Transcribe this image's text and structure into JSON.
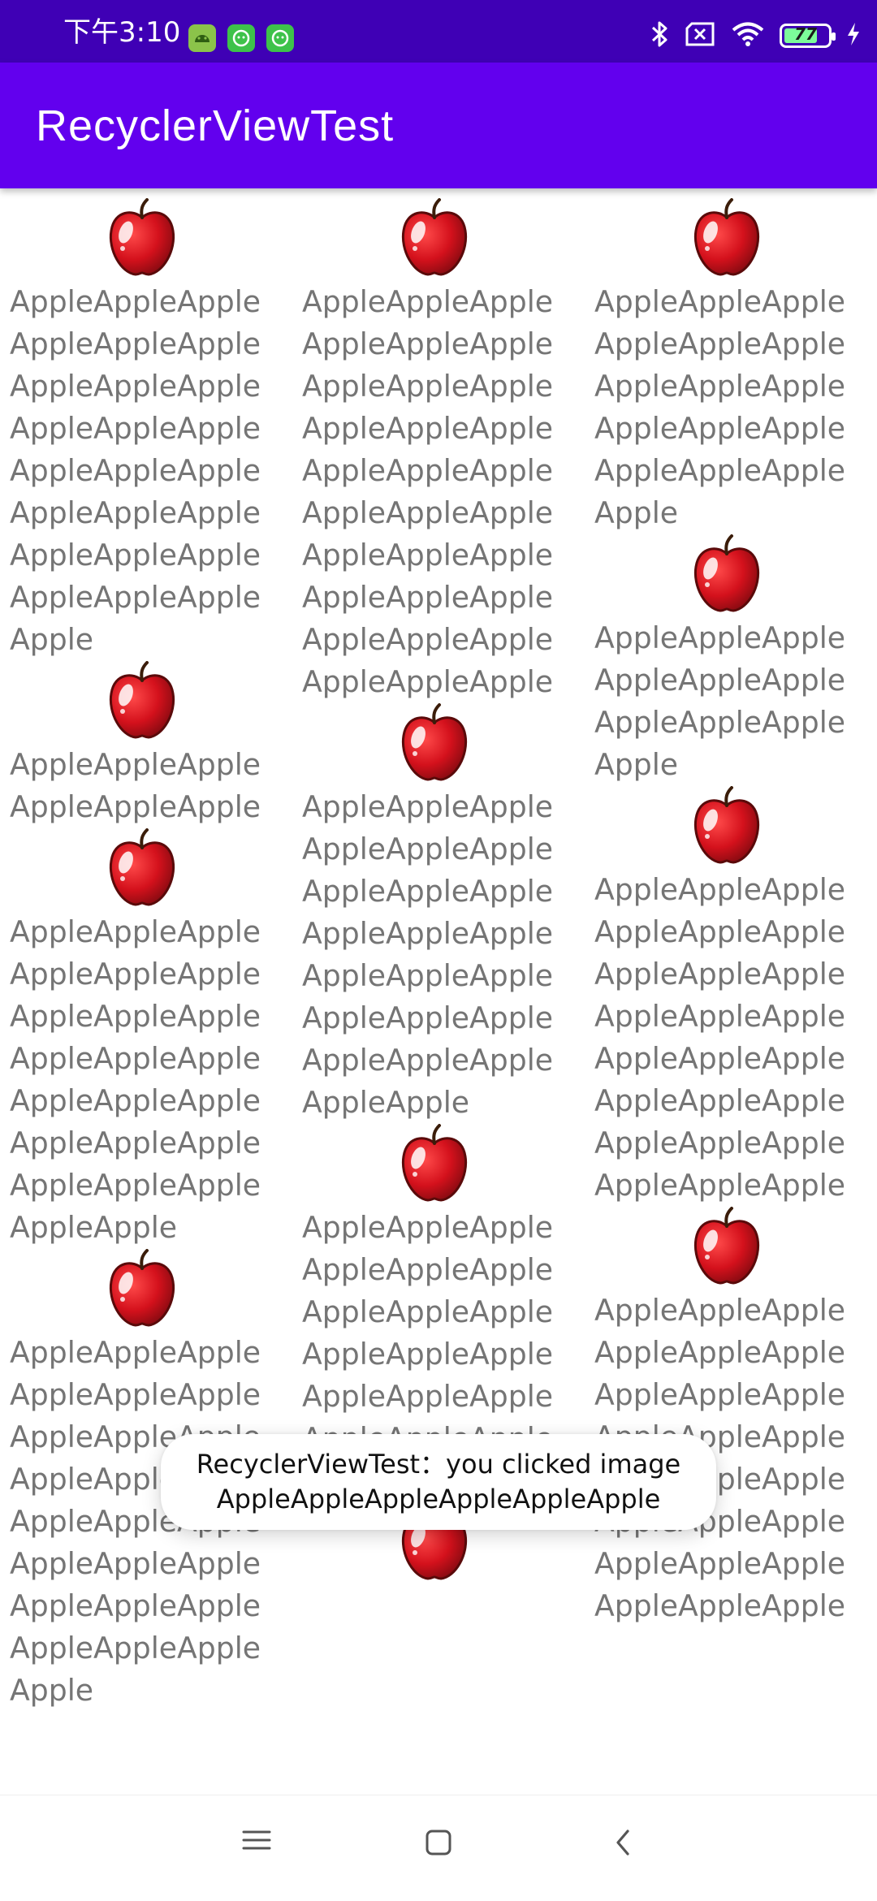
{
  "status_bar": {
    "time": "下午3:10",
    "battery_level": "77",
    "battery_fraction": 0.77,
    "icons": [
      "android-app-icon",
      "app-icon-green",
      "app-icon-green",
      "bluetooth-icon",
      "no-sim-icon",
      "wifi-icon",
      "battery-icon",
      "charging-icon"
    ]
  },
  "app_bar": {
    "title": "RecyclerViewTest"
  },
  "grid": {
    "columns": [
      {
        "items": [
          {
            "icon": "apple-icon",
            "name": "AppleAppleAppleAppleAppleAppleAppleAppleAppleAppleAppleAppleAppleAppleAppleAppleAppleAppleAppleAppleAppleAppleAppleAppleApple"
          },
          {
            "icon": "apple-icon",
            "name": "AppleAppleAppleAppleAppleApple"
          },
          {
            "icon": "apple-icon",
            "name": "AppleAppleAppleAppleAppleAppleAppleAppleAppleAppleAppleAppleAppleAppleAppleAppleAppleAppleAppleAppleAppleAppleApple"
          },
          {
            "icon": "apple-icon",
            "name": "AppleAppleAppleAppleAppleAppleAppleAppleAppleAppleAppleAppleAppleAppleAppleAppleAppleAppleAppleAppleAppleAppleAppleAppleApple"
          }
        ]
      },
      {
        "items": [
          {
            "icon": "apple-icon",
            "name": "AppleAppleAppleAppleAppleAppleAppleAppleAppleAppleAppleAppleAppleAppleAppleAppleAppleAppleAppleAppleAppleAppleAppleAppleAppleAppleAppleAppleAppleApple"
          },
          {
            "icon": "apple-icon",
            "name": "AppleAppleAppleAppleAppleAppleAppleAppleAppleAppleAppleAppleAppleAppleAppleAppleAppleAppleAppleAppleAppleAppleApple"
          },
          {
            "icon": "apple-icon",
            "name": "AppleAppleAppleAppleAppleAppleAppleAppleAppleAppleAppleAppleAppleAppleAppleAppleAppleAppleApple"
          },
          {
            "icon": "apple-icon",
            "name": ""
          }
        ]
      },
      {
        "items": [
          {
            "icon": "apple-icon",
            "name": "AppleAppleAppleAppleAppleAppleAppleAppleAppleAppleAppleAppleAppleAppleAppleApple"
          },
          {
            "icon": "apple-icon",
            "name": "AppleAppleAppleAppleAppleAppleAppleAppleAppleApple"
          },
          {
            "icon": "apple-icon",
            "name": "AppleAppleAppleAppleAppleAppleAppleAppleAppleAppleAppleAppleAppleAppleAppleAppleAppleAppleAppleAppleAppleAppleAppleApple"
          },
          {
            "icon": "apple-icon",
            "name": "AppleAppleAppleAppleAppleAppleAppleAppleAppleAppleAppleAppleAppleAppleAppleAppleAppleAppleAppleAppleAppleAppleAppleApple"
          }
        ]
      }
    ]
  },
  "toast": {
    "line1": "RecyclerViewTest：you clicked image",
    "line2": "AppleAppleAppleAppleAppleApple"
  },
  "nav_bar": {
    "icons": [
      "menu-icon",
      "home-icon",
      "back-icon"
    ]
  },
  "colors": {
    "status_bar": "#3f00b5",
    "app_bar": "#6200ee",
    "item_text": "#757575",
    "apple_red": "#d4111c"
  }
}
